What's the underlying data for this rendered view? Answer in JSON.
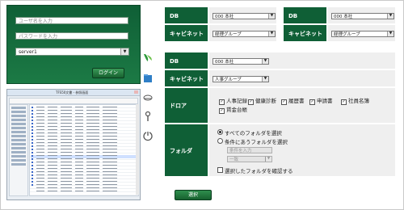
{
  "login": {
    "username_placeholder": "ユーザ名を入力",
    "password_placeholder": "パスワードを入力",
    "server_value": "server1",
    "login_button": "ログイン"
  },
  "top": {
    "left": {
      "db_label": "DB",
      "db_value": "000 本社",
      "cabinet_label": "キャビネット",
      "cabinet_value": "経理グループ"
    },
    "right": {
      "db_label": "DB",
      "db_value": "000 本社",
      "cabinet_label": "キャビネット",
      "cabinet_value": "経理グループ"
    }
  },
  "main": {
    "db_label": "DB",
    "db_value": "000 本社",
    "cabinet_label": "キャビネット",
    "cabinet_value": "人事グループ",
    "drawer_label": "ドロア",
    "drawers": [
      {
        "label": "人事記録",
        "checked": true
      },
      {
        "label": "健康診断",
        "checked": true
      },
      {
        "label": "履歴書",
        "checked": true
      },
      {
        "label": "申請書",
        "checked": true
      },
      {
        "label": "社員名簿",
        "checked": true
      },
      {
        "label": "賃金台帳",
        "checked": true
      }
    ],
    "folder_label": "フォルダ",
    "folder_option_all": "すべてのフォルダを選択",
    "folder_option_match": "条件にあうフォルダを選択",
    "condition_field_placeholder": "条件を入力",
    "condition_match_value": "一致",
    "confirm_selected": "選択したフォルダを確認する",
    "select_button": "選択"
  },
  "thumbnail": {
    "window_title": "TFS50文書 - 参照画面"
  },
  "icons": [
    "logo-leaf-icon",
    "folder-icon",
    "server-icon",
    "key-icon",
    "logout-icon"
  ],
  "colors": {
    "brand_green": "#0f5f36",
    "panel_gray": "#efefef"
  }
}
